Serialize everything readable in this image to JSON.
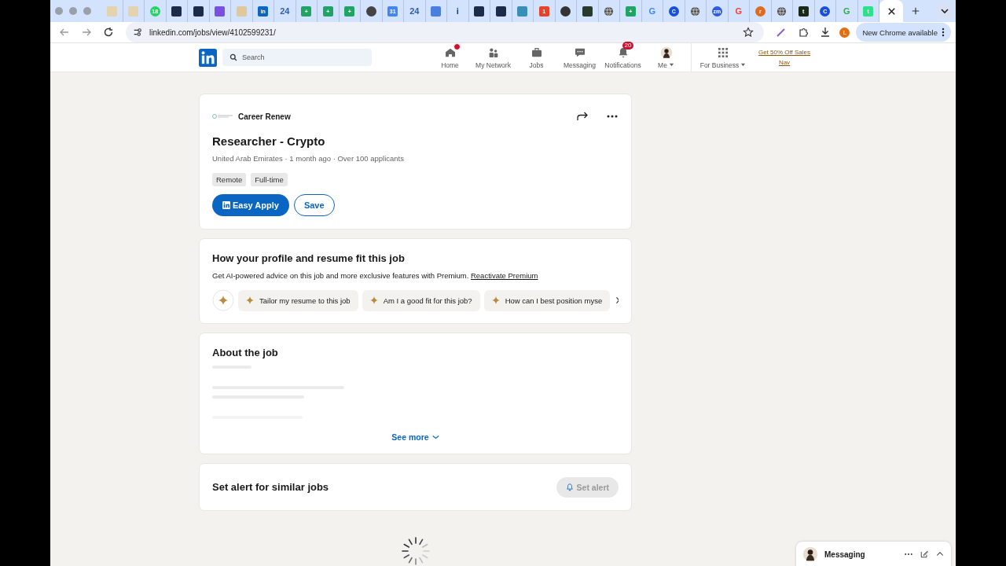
{
  "browser": {
    "tabs": [
      {
        "kind": "square",
        "color": "#e3d3ae",
        "selected": false
      },
      {
        "kind": "square",
        "color": "#e3d3ae",
        "selected": false
      },
      {
        "kind": "circle",
        "color": "#25d366",
        "label": "18",
        "selected": false
      },
      {
        "kind": "square",
        "color": "#1c2b4a",
        "selected": false
      },
      {
        "kind": "square",
        "color": "#1c2b4a",
        "selected": false
      },
      {
        "kind": "square",
        "color": "#7b4fe0",
        "selected": false
      },
      {
        "kind": "square",
        "color": "#e0c89a",
        "selected": false
      },
      {
        "kind": "square",
        "color": "#0a66c2",
        "label": "in",
        "selected": false
      },
      {
        "kind": "glyph",
        "color": "#2f5fa7",
        "label": "24",
        "selected": false
      },
      {
        "kind": "square",
        "color": "#1fa463",
        "label": "+",
        "selected": false
      },
      {
        "kind": "square",
        "color": "#1fa463",
        "label": "+",
        "selected": false
      },
      {
        "kind": "square",
        "color": "#1fa463",
        "label": "+",
        "selected": false
      },
      {
        "kind": "circle",
        "color": "#444444",
        "selected": false
      },
      {
        "kind": "square",
        "color": "#4285f4",
        "label": "31",
        "selected": false
      },
      {
        "kind": "glyph",
        "color": "#2f5fa7",
        "label": "24",
        "selected": false
      },
      {
        "kind": "square",
        "color": "#4a7fe0",
        "selected": false
      },
      {
        "kind": "glyph",
        "color": "#1c3a8a",
        "label": "i",
        "selected": false
      },
      {
        "kind": "square",
        "color": "#1c2b4a",
        "selected": false
      },
      {
        "kind": "square",
        "color": "#1c2b4a",
        "selected": false
      },
      {
        "kind": "square",
        "color": "#3a8fb7",
        "selected": false
      },
      {
        "kind": "square",
        "color": "#e8412c",
        "label": "1",
        "selected": false
      },
      {
        "kind": "circle",
        "color": "#333333",
        "selected": false
      },
      {
        "kind": "square",
        "color": "#2a3a2a",
        "selected": false
      },
      {
        "kind": "globe",
        "color": "#555555",
        "selected": false
      },
      {
        "kind": "square",
        "color": "#1fa463",
        "label": "+",
        "selected": false
      },
      {
        "kind": "glyph",
        "color": "#4285f4",
        "label": "G",
        "selected": false
      },
      {
        "kind": "circle",
        "color": "#1a4fd8",
        "label": "C",
        "selected": false
      },
      {
        "kind": "globe",
        "color": "#555555",
        "selected": false
      },
      {
        "kind": "circle",
        "color": "#2d5be3",
        "label": "zm",
        "selected": false
      },
      {
        "kind": "glyph",
        "color": "#ea4335",
        "label": "G",
        "selected": false
      },
      {
        "kind": "circle",
        "color": "#e06a1e",
        "label": "r",
        "selected": false
      },
      {
        "kind": "globe",
        "color": "#555555",
        "selected": false
      },
      {
        "kind": "square",
        "color": "#1a2a1a",
        "label": "t",
        "selected": false
      },
      {
        "kind": "circle",
        "color": "#1a4fd8",
        "label": "C",
        "selected": false
      },
      {
        "kind": "glyph",
        "color": "#34a853",
        "label": "G",
        "selected": false
      },
      {
        "kind": "square",
        "color": "#2de08a",
        "label": "t",
        "selected": false
      },
      {
        "kind": "close",
        "selected": true
      }
    ],
    "url": "linkedin.com/jobs/view/4102599231/",
    "profile_initial": "L",
    "update_button": "New Chrome available"
  },
  "nav": {
    "search_placeholder": "Search",
    "items": [
      {
        "kind": "home",
        "label": "Home",
        "badge_dot": true
      },
      {
        "kind": "network",
        "label": "My Network"
      },
      {
        "kind": "jobs",
        "label": "Jobs"
      },
      {
        "kind": "messaging",
        "label": "Messaging"
      },
      {
        "kind": "notifications",
        "label": "Notifications",
        "badge": "20"
      },
      {
        "kind": "me",
        "label": "Me"
      }
    ],
    "business": "For Business",
    "promo": "Get 50% Off Sales Nav"
  },
  "job": {
    "company": "Career Renew",
    "title": "Researcher - Crypto",
    "meta": "United Arab Emirates · 1 month ago · Over 100 applicants",
    "tags": [
      "Remote",
      "Full-time"
    ],
    "apply_button": "Easy Apply",
    "save_button": "Save"
  },
  "fit": {
    "heading": "How your profile and resume fit this job",
    "text": "Get AI-powered advice on this job and more exclusive features with Premium.",
    "link": "Reactivate Premium",
    "prompts": [
      "Tailor my resume to this job",
      "Am I a good fit for this job?",
      "How can I best position myse"
    ]
  },
  "about": {
    "heading": "About the job",
    "see_more": "See more"
  },
  "alert": {
    "heading": "Set alert for similar jobs",
    "button": "Set alert",
    "disabled": true
  },
  "messaging": {
    "label": "Messaging"
  }
}
